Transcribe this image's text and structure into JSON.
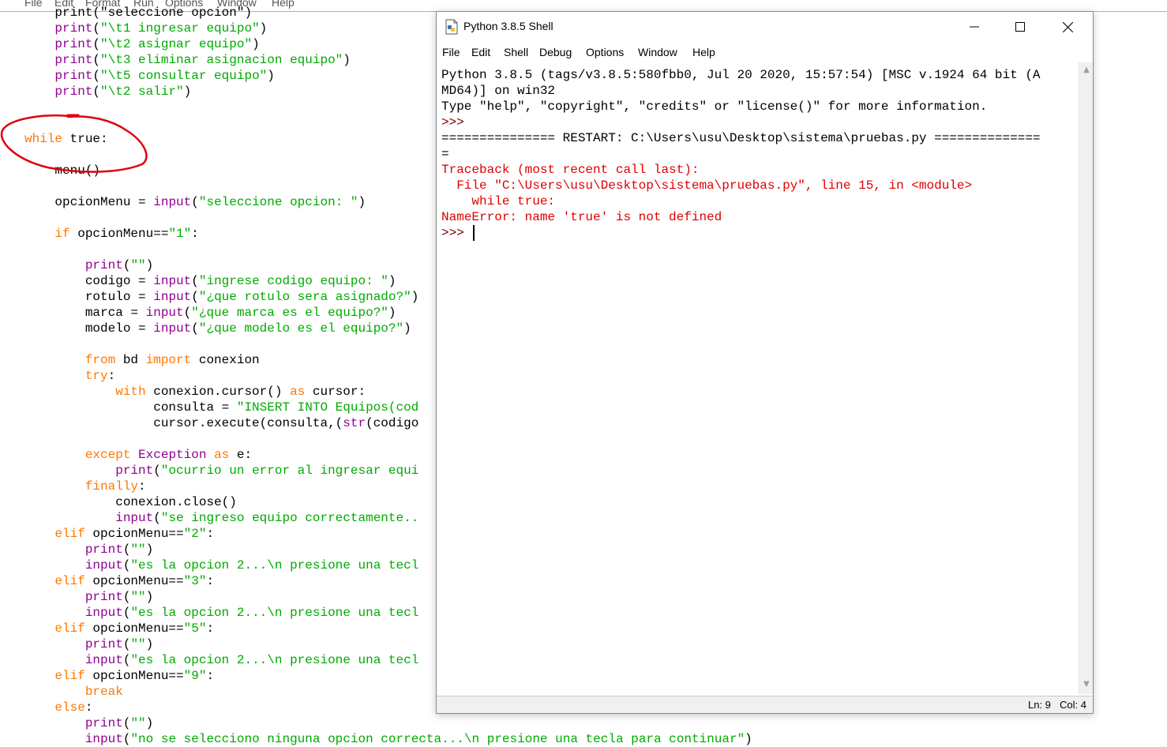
{
  "editor": {
    "menu": [
      "File",
      "Edit",
      "Format",
      "Run",
      "Options",
      "Window",
      "Help"
    ],
    "lines": [
      {
        "indent": 0,
        "segments": [
          {
            "t": "    print(\"seleccione opcion\")",
            "c": "plain"
          }
        ]
      },
      {
        "indent": 0,
        "segments": [
          {
            "t": "    ",
            "c": "plain"
          },
          {
            "t": "print",
            "c": "b"
          },
          {
            "t": "(",
            "c": "plain"
          },
          {
            "t": "\"\\t1 ingresar equipo\"",
            "c": "s"
          },
          {
            "t": ")",
            "c": "plain"
          }
        ]
      },
      {
        "indent": 0,
        "segments": [
          {
            "t": "    ",
            "c": "plain"
          },
          {
            "t": "print",
            "c": "b"
          },
          {
            "t": "(",
            "c": "plain"
          },
          {
            "t": "\"\\t2 asignar equipo\"",
            "c": "s"
          },
          {
            "t": ")",
            "c": "plain"
          }
        ]
      },
      {
        "indent": 0,
        "segments": [
          {
            "t": "    ",
            "c": "plain"
          },
          {
            "t": "print",
            "c": "b"
          },
          {
            "t": "(",
            "c": "plain"
          },
          {
            "t": "\"\\t3 eliminar asignacion equipo\"",
            "c": "s"
          },
          {
            "t": ")",
            "c": "plain"
          }
        ]
      },
      {
        "indent": 0,
        "segments": [
          {
            "t": "    ",
            "c": "plain"
          },
          {
            "t": "print",
            "c": "b"
          },
          {
            "t": "(",
            "c": "plain"
          },
          {
            "t": "\"\\t5 consultar equipo\"",
            "c": "s"
          },
          {
            "t": ")",
            "c": "plain"
          }
        ]
      },
      {
        "indent": 0,
        "segments": [
          {
            "t": "    ",
            "c": "plain"
          },
          {
            "t": "print",
            "c": "b"
          },
          {
            "t": "(",
            "c": "plain"
          },
          {
            "t": "\"\\t2 salir\"",
            "c": "s"
          },
          {
            "t": ")",
            "c": "plain"
          }
        ]
      },
      {
        "indent": 0,
        "segments": []
      },
      {
        "indent": 0,
        "segments": []
      },
      {
        "indent": 0,
        "segments": [
          {
            "t": "while",
            "c": "k"
          },
          {
            "t": " true:",
            "c": "plain"
          }
        ]
      },
      {
        "indent": 0,
        "segments": []
      },
      {
        "indent": 0,
        "segments": [
          {
            "t": "    menu()",
            "c": "plain"
          }
        ]
      },
      {
        "indent": 0,
        "segments": []
      },
      {
        "indent": 0,
        "segments": [
          {
            "t": "    opcionMenu = ",
            "c": "plain"
          },
          {
            "t": "input",
            "c": "b"
          },
          {
            "t": "(",
            "c": "plain"
          },
          {
            "t": "\"seleccione opcion: \"",
            "c": "s"
          },
          {
            "t": ")",
            "c": "plain"
          }
        ]
      },
      {
        "indent": 0,
        "segments": []
      },
      {
        "indent": 0,
        "segments": [
          {
            "t": "    ",
            "c": "plain"
          },
          {
            "t": "if",
            "c": "k"
          },
          {
            "t": " opcionMenu==",
            "c": "plain"
          },
          {
            "t": "\"1\"",
            "c": "s"
          },
          {
            "t": ":",
            "c": "plain"
          }
        ]
      },
      {
        "indent": 0,
        "segments": []
      },
      {
        "indent": 0,
        "segments": [
          {
            "t": "        ",
            "c": "plain"
          },
          {
            "t": "print",
            "c": "b"
          },
          {
            "t": "(",
            "c": "plain"
          },
          {
            "t": "\"\"",
            "c": "s"
          },
          {
            "t": ")",
            "c": "plain"
          }
        ]
      },
      {
        "indent": 0,
        "segments": [
          {
            "t": "        codigo = ",
            "c": "plain"
          },
          {
            "t": "input",
            "c": "b"
          },
          {
            "t": "(",
            "c": "plain"
          },
          {
            "t": "\"ingrese codigo equipo: \"",
            "c": "s"
          },
          {
            "t": ")",
            "c": "plain"
          }
        ]
      },
      {
        "indent": 0,
        "segments": [
          {
            "t": "        rotulo = ",
            "c": "plain"
          },
          {
            "t": "input",
            "c": "b"
          },
          {
            "t": "(",
            "c": "plain"
          },
          {
            "t": "\"¿que rotulo sera asignado?\"",
            "c": "s"
          },
          {
            "t": ")",
            "c": "plain"
          }
        ]
      },
      {
        "indent": 0,
        "segments": [
          {
            "t": "        marca = ",
            "c": "plain"
          },
          {
            "t": "input",
            "c": "b"
          },
          {
            "t": "(",
            "c": "plain"
          },
          {
            "t": "\"¿que marca es el equipo?\"",
            "c": "s"
          },
          {
            "t": ")",
            "c": "plain"
          }
        ]
      },
      {
        "indent": 0,
        "segments": [
          {
            "t": "        modelo = ",
            "c": "plain"
          },
          {
            "t": "input",
            "c": "b"
          },
          {
            "t": "(",
            "c": "plain"
          },
          {
            "t": "\"¿que modelo es el equipo?\"",
            "c": "s"
          },
          {
            "t": ")",
            "c": "plain"
          }
        ]
      },
      {
        "indent": 0,
        "segments": []
      },
      {
        "indent": 0,
        "segments": [
          {
            "t": "        ",
            "c": "plain"
          },
          {
            "t": "from",
            "c": "k"
          },
          {
            "t": " bd ",
            "c": "plain"
          },
          {
            "t": "import",
            "c": "k"
          },
          {
            "t": " conexion",
            "c": "plain"
          }
        ]
      },
      {
        "indent": 0,
        "segments": [
          {
            "t": "        ",
            "c": "plain"
          },
          {
            "t": "try",
            "c": "k"
          },
          {
            "t": ":",
            "c": "plain"
          }
        ]
      },
      {
        "indent": 0,
        "segments": [
          {
            "t": "            ",
            "c": "plain"
          },
          {
            "t": "with",
            "c": "k"
          },
          {
            "t": " conexion.cursor() ",
            "c": "plain"
          },
          {
            "t": "as",
            "c": "k"
          },
          {
            "t": " cursor:",
            "c": "plain"
          }
        ]
      },
      {
        "indent": 0,
        "segments": [
          {
            "t": "                 consulta = ",
            "c": "plain"
          },
          {
            "t": "\"INSERT INTO Equipos(cod",
            "c": "s"
          }
        ]
      },
      {
        "indent": 0,
        "segments": [
          {
            "t": "                 cursor.execute(consulta,(",
            "c": "plain"
          },
          {
            "t": "str",
            "c": "b"
          },
          {
            "t": "(codigo",
            "c": "plain"
          }
        ]
      },
      {
        "indent": 0,
        "segments": []
      },
      {
        "indent": 0,
        "segments": [
          {
            "t": "        ",
            "c": "plain"
          },
          {
            "t": "except",
            "c": "k"
          },
          {
            "t": " ",
            "c": "plain"
          },
          {
            "t": "Exception",
            "c": "b"
          },
          {
            "t": " ",
            "c": "plain"
          },
          {
            "t": "as",
            "c": "k"
          },
          {
            "t": " e:",
            "c": "plain"
          }
        ]
      },
      {
        "indent": 0,
        "segments": [
          {
            "t": "            ",
            "c": "plain"
          },
          {
            "t": "print",
            "c": "b"
          },
          {
            "t": "(",
            "c": "plain"
          },
          {
            "t": "\"ocurrio un error al ingresar equi",
            "c": "s"
          }
        ]
      },
      {
        "indent": 0,
        "segments": [
          {
            "t": "        ",
            "c": "plain"
          },
          {
            "t": "finally",
            "c": "k"
          },
          {
            "t": ":",
            "c": "plain"
          }
        ]
      },
      {
        "indent": 0,
        "segments": [
          {
            "t": "            conexion.close()",
            "c": "plain"
          }
        ]
      },
      {
        "indent": 0,
        "segments": [
          {
            "t": "            ",
            "c": "plain"
          },
          {
            "t": "input",
            "c": "b"
          },
          {
            "t": "(",
            "c": "plain"
          },
          {
            "t": "\"se ingreso equipo correctamente..",
            "c": "s"
          }
        ]
      },
      {
        "indent": 0,
        "segments": [
          {
            "t": "    ",
            "c": "plain"
          },
          {
            "t": "elif",
            "c": "k"
          },
          {
            "t": " opcionMenu==",
            "c": "plain"
          },
          {
            "t": "\"2\"",
            "c": "s"
          },
          {
            "t": ":",
            "c": "plain"
          }
        ]
      },
      {
        "indent": 0,
        "segments": [
          {
            "t": "        ",
            "c": "plain"
          },
          {
            "t": "print",
            "c": "b"
          },
          {
            "t": "(",
            "c": "plain"
          },
          {
            "t": "\"\"",
            "c": "s"
          },
          {
            "t": ")",
            "c": "plain"
          }
        ]
      },
      {
        "indent": 0,
        "segments": [
          {
            "t": "        ",
            "c": "plain"
          },
          {
            "t": "input",
            "c": "b"
          },
          {
            "t": "(",
            "c": "plain"
          },
          {
            "t": "\"es la opcion 2...\\n presione una tecl",
            "c": "s"
          }
        ]
      },
      {
        "indent": 0,
        "segments": [
          {
            "t": "    ",
            "c": "plain"
          },
          {
            "t": "elif",
            "c": "k"
          },
          {
            "t": " opcionMenu==",
            "c": "plain"
          },
          {
            "t": "\"3\"",
            "c": "s"
          },
          {
            "t": ":",
            "c": "plain"
          }
        ]
      },
      {
        "indent": 0,
        "segments": [
          {
            "t": "        ",
            "c": "plain"
          },
          {
            "t": "print",
            "c": "b"
          },
          {
            "t": "(",
            "c": "plain"
          },
          {
            "t": "\"\"",
            "c": "s"
          },
          {
            "t": ")",
            "c": "plain"
          }
        ]
      },
      {
        "indent": 0,
        "segments": [
          {
            "t": "        ",
            "c": "plain"
          },
          {
            "t": "input",
            "c": "b"
          },
          {
            "t": "(",
            "c": "plain"
          },
          {
            "t": "\"es la opcion 2...\\n presione una tecl",
            "c": "s"
          }
        ]
      },
      {
        "indent": 0,
        "segments": [
          {
            "t": "    ",
            "c": "plain"
          },
          {
            "t": "elif",
            "c": "k"
          },
          {
            "t": " opcionMenu==",
            "c": "plain"
          },
          {
            "t": "\"5\"",
            "c": "s"
          },
          {
            "t": ":",
            "c": "plain"
          }
        ]
      },
      {
        "indent": 0,
        "segments": [
          {
            "t": "        ",
            "c": "plain"
          },
          {
            "t": "print",
            "c": "b"
          },
          {
            "t": "(",
            "c": "plain"
          },
          {
            "t": "\"\"",
            "c": "s"
          },
          {
            "t": ")",
            "c": "plain"
          }
        ]
      },
      {
        "indent": 0,
        "segments": [
          {
            "t": "        ",
            "c": "plain"
          },
          {
            "t": "input",
            "c": "b"
          },
          {
            "t": "(",
            "c": "plain"
          },
          {
            "t": "\"es la opcion 2...\\n presione una tecl",
            "c": "s"
          }
        ]
      },
      {
        "indent": 0,
        "segments": [
          {
            "t": "    ",
            "c": "plain"
          },
          {
            "t": "elif",
            "c": "k"
          },
          {
            "t": " opcionMenu==",
            "c": "plain"
          },
          {
            "t": "\"9\"",
            "c": "s"
          },
          {
            "t": ":",
            "c": "plain"
          }
        ]
      },
      {
        "indent": 0,
        "segments": [
          {
            "t": "        ",
            "c": "plain"
          },
          {
            "t": "break",
            "c": "k"
          }
        ]
      },
      {
        "indent": 0,
        "segments": [
          {
            "t": "    ",
            "c": "plain"
          },
          {
            "t": "else",
            "c": "k"
          },
          {
            "t": ":",
            "c": "plain"
          }
        ]
      },
      {
        "indent": 0,
        "segments": [
          {
            "t": "        ",
            "c": "plain"
          },
          {
            "t": "print",
            "c": "b"
          },
          {
            "t": "(",
            "c": "plain"
          },
          {
            "t": "\"\"",
            "c": "s"
          },
          {
            "t": ")",
            "c": "plain"
          }
        ]
      },
      {
        "indent": 0,
        "segments": [
          {
            "t": "        ",
            "c": "plain"
          },
          {
            "t": "input",
            "c": "b"
          },
          {
            "t": "(",
            "c": "plain"
          },
          {
            "t": "\"no se selecciono ninguna opcion correcta...\\n presione una tecla para continuar\"",
            "c": "s"
          },
          {
            "t": ")",
            "c": "plain"
          }
        ]
      }
    ]
  },
  "shell": {
    "title": "Python 3.8.5 Shell",
    "menu": [
      "File",
      "Edit",
      "Shell",
      "Debug",
      "Options",
      "Window",
      "Help"
    ],
    "lines": [
      {
        "t": "Python 3.8.5 (tags/v3.8.5:580fbb0, Jul 20 2020, 15:57:54) [MSC v.1924 64 bit (A",
        "c": "stdout"
      },
      {
        "t": "MD64)] on win32",
        "c": "stdout"
      },
      {
        "t": "Type \"help\", \"copyright\", \"credits\" or \"license()\" for more information.",
        "c": "stdout"
      },
      {
        "t": ">>> ",
        "c": "maroon"
      },
      {
        "t": "=============== RESTART: C:\\Users\\usu\\Desktop\\sistema\\pruebas.py ==============",
        "c": "stdout"
      },
      {
        "t": "=",
        "c": "stdout"
      },
      {
        "t": "Traceback (most recent call last):",
        "c": "red"
      },
      {
        "t": "  File \"C:\\Users\\usu\\Desktop\\sistema\\pruebas.py\", line 15, in <module>",
        "c": "red"
      },
      {
        "t": "    while true:",
        "c": "red"
      },
      {
        "t": "NameError: name 'true' is not defined",
        "c": "red"
      },
      {
        "t": ">>> ",
        "c": "maroon"
      }
    ],
    "status": {
      "ln": "Ln: 9",
      "col": "Col: 4"
    }
  },
  "colors": {
    "keyword": "#ff7700",
    "builtin": "#900090",
    "string": "#00aa00",
    "error": "#dd0000",
    "prompt": "#770000",
    "annotation": "#e0000f"
  },
  "icons": [
    "python-file-icon",
    "minimize-icon",
    "maximize-icon",
    "close-icon",
    "scroll-up-icon",
    "scroll-down-icon"
  ]
}
